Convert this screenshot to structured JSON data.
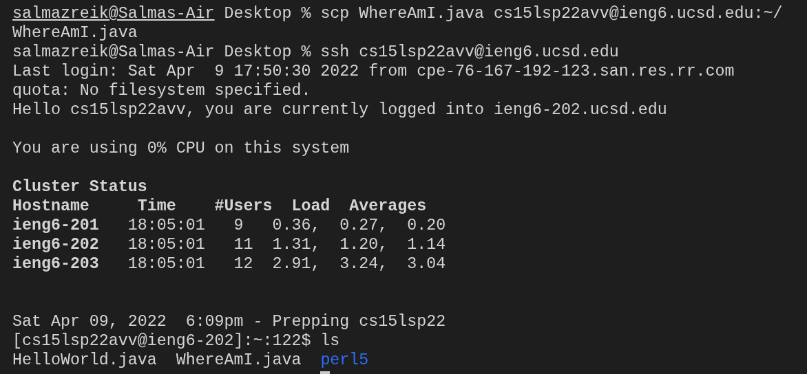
{
  "terminal": {
    "lines": [
      {
        "kind": "text",
        "segments": [
          {
            "text": "salmazreik@Salmas-Air",
            "kind": "underline"
          },
          {
            "text": " Desktop % scp WhereAmI.java cs15lsp22avv@ieng6.ucsd.edu:~/",
            "kind": "plain"
          }
        ]
      },
      {
        "kind": "text",
        "segments": [
          {
            "text": "WhereAmI.java",
            "kind": "plain"
          }
        ]
      },
      {
        "kind": "text",
        "segments": [
          {
            "text": "salmazreik@Salmas-Air Desktop % ssh cs15lsp22avv@ieng6.ucsd.edu",
            "kind": "plain"
          }
        ]
      },
      {
        "kind": "text",
        "segments": [
          {
            "text": "Last login: Sat Apr  9 17:50:30 2022 from cpe-76-167-192-123.san.res.rr.com",
            "kind": "plain"
          }
        ]
      },
      {
        "kind": "text",
        "segments": [
          {
            "text": "quota: No filesystem specified.",
            "kind": "plain"
          }
        ]
      },
      {
        "kind": "text",
        "segments": [
          {
            "text": "Hello cs15lsp22avv, you are currently logged into ieng6-202.ucsd.edu",
            "kind": "plain"
          }
        ]
      },
      {
        "kind": "blank"
      },
      {
        "kind": "text",
        "segments": [
          {
            "text": "You are using 0% CPU on this system",
            "kind": "plain"
          }
        ]
      },
      {
        "kind": "blank"
      },
      {
        "kind": "text",
        "segments": [
          {
            "text": "Cluster Status",
            "kind": "bold"
          }
        ]
      },
      {
        "kind": "text",
        "segments": [
          {
            "text": "Hostname     Time    #Users  Load  Averages",
            "kind": "bold"
          }
        ]
      },
      {
        "kind": "text",
        "segments": [
          {
            "text": "ieng6-201",
            "kind": "bold"
          },
          {
            "text": "   18:05:01   9   0.36,  0.27,  0.20",
            "kind": "plain"
          }
        ]
      },
      {
        "kind": "text",
        "segments": [
          {
            "text": "ieng6-202",
            "kind": "bold"
          },
          {
            "text": "   18:05:01   11  1.31,  1.20,  1.14",
            "kind": "plain"
          }
        ]
      },
      {
        "kind": "text",
        "segments": [
          {
            "text": "ieng6-203",
            "kind": "bold"
          },
          {
            "text": "   18:05:01   12  2.91,  3.24,  3.04",
            "kind": "plain"
          }
        ]
      },
      {
        "kind": "blank"
      },
      {
        "kind": "blank"
      },
      {
        "kind": "text",
        "segments": [
          {
            "text": "Sat Apr 09, 2022  6:09pm - Prepping cs15lsp22",
            "kind": "plain"
          }
        ]
      },
      {
        "kind": "text",
        "segments": [
          {
            "text": "[cs15lsp22avv@ieng6-202]:~:122$ ls",
            "kind": "plain"
          }
        ]
      },
      {
        "kind": "text",
        "segments": [
          {
            "text": "HelloWorld.java  WhereAmI.java  ",
            "kind": "plain"
          },
          {
            "text": "perl5",
            "kind": "directory"
          }
        ]
      },
      {
        "kind": "cursor"
      }
    ]
  }
}
